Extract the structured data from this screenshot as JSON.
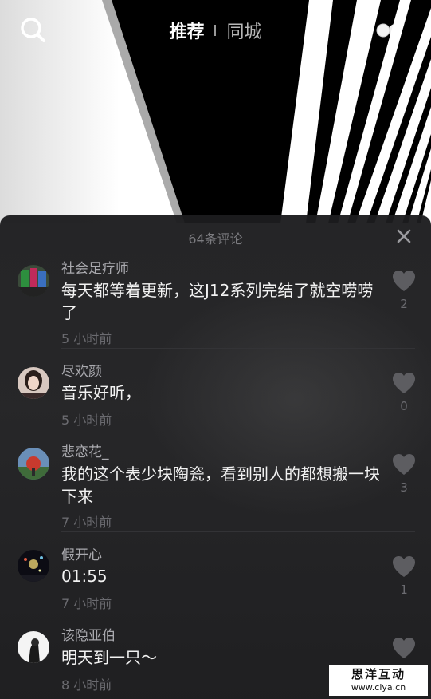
{
  "header": {
    "tabs": [
      {
        "label": "推荐",
        "active": true
      },
      {
        "label": "同城",
        "active": false
      }
    ],
    "search_icon": "search-icon",
    "live_icon": "live-dots-icon"
  },
  "comments_panel": {
    "title": "64条评论",
    "close_icon": "close-icon",
    "comments": [
      {
        "author": "社会足疗师",
        "text": "每天都等着更新，这J12系列完结了就空唠唠了",
        "time": "5 小时前",
        "likes": "2"
      },
      {
        "author": "尽欢颜",
        "text": "音乐好听，",
        "time": "5 小时前",
        "likes": "0"
      },
      {
        "author": "悲恋花_",
        "text": "我的这个表少块陶瓷，看到别人的都想搬一块下来",
        "time": "7 小时前",
        "likes": "3"
      },
      {
        "author": "假开心",
        "text": "01:55",
        "time": "7 小时前",
        "likes": "1"
      },
      {
        "author": "该隐亚伯",
        "text": "明天到一只～",
        "time": "8 小时前",
        "likes": ""
      }
    ]
  },
  "watermark": {
    "title": "思洋互动",
    "url": "www.ciya.cn"
  },
  "colors": {
    "sheet_bg": "#1d1d1f",
    "text_primary": "#f2f2f2",
    "text_secondary": "#6b6b70"
  }
}
